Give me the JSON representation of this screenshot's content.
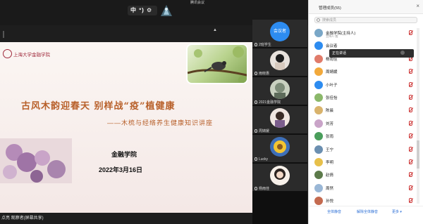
{
  "window": {
    "title": "腾讯会议"
  },
  "topbar": {
    "badge": "中 º) ⚙"
  },
  "icons": {
    "collapse": "▲",
    "close": "×"
  },
  "slide": {
    "school": "上海大学金融学院",
    "title": "古风木韵迎春天 别样战“疫”植健康",
    "subtitle": "——木梳与经络养生健康知识讲座",
    "organizer": "金融学院",
    "date": "2022年3月16日"
  },
  "presenter": {
    "caption": "点亮 观察者(屏幕共享)"
  },
  "tiles": [
    {
      "name": "2班学生",
      "avatar_text": "会议者"
    },
    {
      "name": "雨晓惠"
    },
    {
      "name": "2021金融学院"
    },
    {
      "name": "周婧媛"
    },
    {
      "name": "Lucky"
    },
    {
      "name": "杨雨佳"
    }
  ],
  "panel": {
    "title": "管理成员(55)",
    "search_placeholder": "搜索成员",
    "participants": [
      {
        "name": "金融学院(主持人)",
        "role": "主持人·我"
      },
      {
        "name": "会议者"
      },
      {
        "name": "杨雨佳"
      },
      {
        "name": "周婧媛"
      },
      {
        "name": "小叶子"
      },
      {
        "name": "张佳怡"
      },
      {
        "name": "陈晨"
      },
      {
        "name": "刘芳"
      },
      {
        "name": "张雨"
      },
      {
        "name": "王宁"
      },
      {
        "name": "李明"
      },
      {
        "name": "赵倩"
      },
      {
        "name": "周然"
      },
      {
        "name": "孙悦"
      }
    ],
    "tooltip": "正在讲话",
    "footer": [
      "全体静音",
      "解除全体静音",
      "更多 ▾"
    ]
  }
}
